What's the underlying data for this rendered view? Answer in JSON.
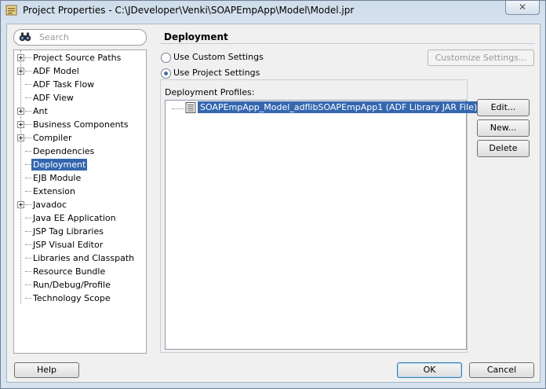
{
  "window": {
    "title": "Project Properties - C:\\JDeveloper\\Venki\\SOAPEmpApp\\Model\\Model.jpr",
    "close_glyph": "✕"
  },
  "search": {
    "placeholder": "Search",
    "value": ""
  },
  "tree": {
    "items": [
      {
        "label": "Project Source Paths",
        "expandable": true,
        "selected": false
      },
      {
        "label": "ADF Model",
        "expandable": true,
        "selected": false
      },
      {
        "label": "ADF Task Flow",
        "expandable": false,
        "selected": false
      },
      {
        "label": "ADF View",
        "expandable": false,
        "selected": false
      },
      {
        "label": "Ant",
        "expandable": true,
        "selected": false
      },
      {
        "label": "Business Components",
        "expandable": true,
        "selected": false
      },
      {
        "label": "Compiler",
        "expandable": true,
        "selected": false
      },
      {
        "label": "Dependencies",
        "expandable": false,
        "selected": false
      },
      {
        "label": "Deployment",
        "expandable": false,
        "selected": true
      },
      {
        "label": "EJB Module",
        "expandable": false,
        "selected": false
      },
      {
        "label": "Extension",
        "expandable": false,
        "selected": false
      },
      {
        "label": "Javadoc",
        "expandable": true,
        "selected": false
      },
      {
        "label": "Java EE Application",
        "expandable": false,
        "selected": false
      },
      {
        "label": "JSP Tag Libraries",
        "expandable": false,
        "selected": false
      },
      {
        "label": "JSP Visual Editor",
        "expandable": false,
        "selected": false
      },
      {
        "label": "Libraries and Classpath",
        "expandable": false,
        "selected": false
      },
      {
        "label": "Resource Bundle",
        "expandable": false,
        "selected": false
      },
      {
        "label": "Run/Debug/Profile",
        "expandable": false,
        "selected": false
      },
      {
        "label": "Technology Scope",
        "expandable": false,
        "selected": false
      }
    ]
  },
  "panel": {
    "title": "Deployment",
    "use_custom_label": "Use Custom Settings",
    "use_project_label": "Use Project Settings",
    "selected_option": "project",
    "customize_label": "Customize Settings...",
    "profiles_label": "Deployment Profiles:",
    "profiles": [
      "SOAPEmpApp_Model_adflibSOAPEmpApp1 (ADF Library JAR File)"
    ],
    "edit_label": "Edit...",
    "new_label": "New...",
    "delete_label": "Delete"
  },
  "footer": {
    "help_label": "Help",
    "ok_label": "OK",
    "cancel_label": "Cancel"
  },
  "colors": {
    "selection": "#3467b0",
    "title_gradient_top": "#cfdcea",
    "client_bg": "#f0f0f0"
  }
}
